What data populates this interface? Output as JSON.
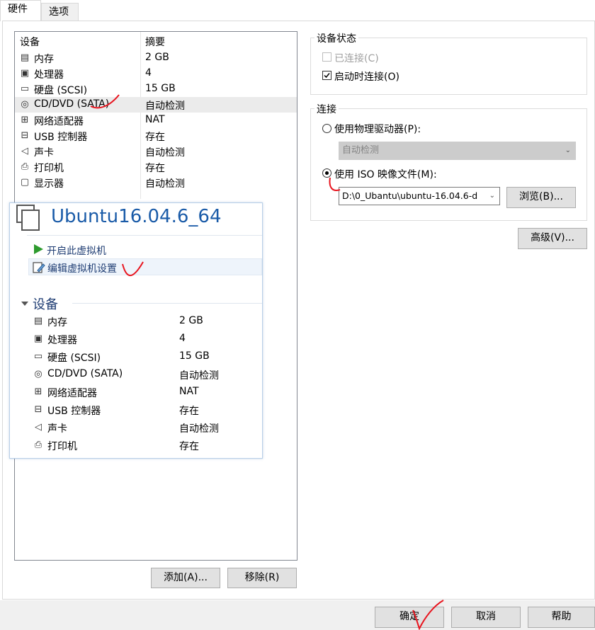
{
  "tabs": [
    "硬件",
    "选项"
  ],
  "device_list": {
    "columns": [
      "设备",
      "摘要"
    ],
    "rows": [
      {
        "name": "内存",
        "summary": "2 GB",
        "icon": "memory-icon"
      },
      {
        "name": "处理器",
        "summary": "4",
        "icon": "processor-icon"
      },
      {
        "name": "硬盘 (SCSI)",
        "summary": "15 GB",
        "icon": "harddisk-icon"
      },
      {
        "name": "CD/DVD (SATA)",
        "summary": "自动检测",
        "icon": "cd-dvd-icon"
      },
      {
        "name": "网络适配器",
        "summary": "NAT",
        "icon": "network-adapter-icon"
      },
      {
        "name": "USB 控制器",
        "summary": "存在",
        "icon": "usb-icon"
      },
      {
        "name": "声卡",
        "summary": "自动检测",
        "icon": "sound-card-icon"
      },
      {
        "name": "打印机",
        "summary": "存在",
        "icon": "printer-icon"
      },
      {
        "name": "显示器",
        "summary": "自动检测",
        "icon": "display-icon"
      }
    ],
    "selected_index": 3
  },
  "buttons": {
    "add": "添加(A)...",
    "remove": "移除(R)",
    "browse": "浏览(B)...",
    "advanced": "高级(V)...",
    "ok": "确定",
    "cancel": "取消",
    "help": "帮助"
  },
  "device_status": {
    "title": "设备状态",
    "connected": {
      "label": "已连接(C)",
      "checked": false,
      "disabled": true
    },
    "connect_at_power_on": {
      "label": "启动时连接(O)",
      "checked": true
    }
  },
  "connection": {
    "title": "连接",
    "physical_drive": {
      "label": "使用物理驱动器(P):",
      "selected": false
    },
    "physical_drive_value": "自动检测",
    "iso_image": {
      "label": "使用 ISO 映像文件(M):",
      "selected": true
    },
    "iso_path": "D:\\0_Ubantu\\ubuntu-16.04.6-d"
  },
  "vm_card": {
    "title": "Ubuntu16.04.6_64",
    "actions": [
      "开启此虚拟机",
      "编辑虚拟机设置"
    ],
    "devices_title": "设备",
    "devices": [
      {
        "name": "内存",
        "summary": "2 GB",
        "icon": "memory-icon"
      },
      {
        "name": "处理器",
        "summary": "4",
        "icon": "processor-icon"
      },
      {
        "name": "硬盘 (SCSI)",
        "summary": "15 GB",
        "icon": "harddisk-icon"
      },
      {
        "name": "CD/DVD (SATA)",
        "summary": "自动检测",
        "icon": "cd-dvd-icon"
      },
      {
        "name": "网络适配器",
        "summary": "NAT",
        "icon": "network-adapter-icon"
      },
      {
        "name": "USB 控制器",
        "summary": "存在",
        "icon": "usb-icon"
      },
      {
        "name": "声卡",
        "summary": "自动检测",
        "icon": "sound-card-icon"
      },
      {
        "name": "打印机",
        "summary": "存在",
        "icon": "printer-icon"
      }
    ]
  },
  "colors": {
    "accent": "#1a5ba8",
    "annotation": "#e8141e",
    "play_green": "#2e9b2e"
  }
}
